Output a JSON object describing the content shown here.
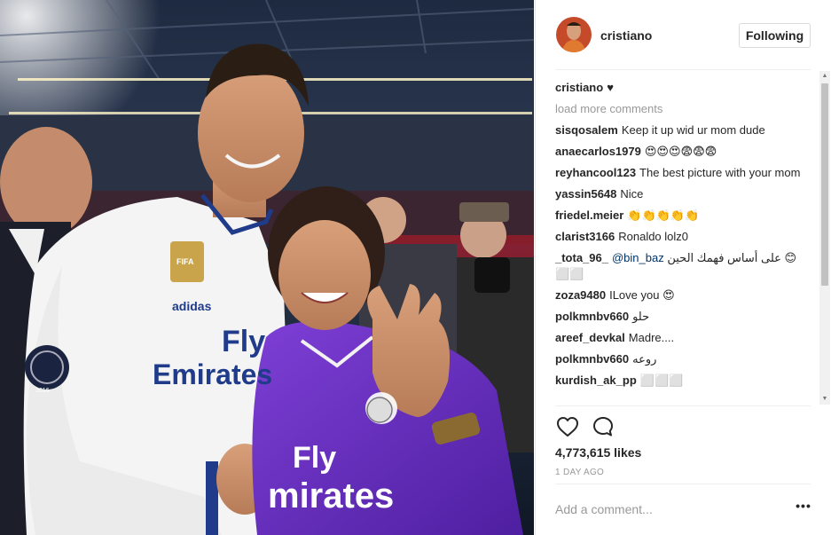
{
  "post": {
    "image_alt": "Cristiano with his mother at the stadium",
    "username": "cristiano",
    "follow_label": "Following"
  },
  "photo_text": {
    "shirt_sponsor_line1": "Fly",
    "shirt_sponsor_line2": "Emirates",
    "mom_sponsor_line1": "Fly",
    "mom_sponsor_line2": "mirates",
    "brand": "adidas",
    "badge": "FIFA",
    "patch_year": "2016"
  },
  "caption": {
    "user": "cristiano",
    "text": "♥"
  },
  "load_more_label": "load more comments",
  "comments": [
    {
      "user": "sisqosalem",
      "text": "Keep it up wid ur mom dude"
    },
    {
      "user": "anaecarlos1979",
      "text": "😍😍😍😨😨😨"
    },
    {
      "user": "reyhancool123",
      "text": "The best picture with your mom"
    },
    {
      "user": "yassin5648",
      "text": "Nice"
    },
    {
      "user": "friedel.meier",
      "text": "👏👏👏👏👏"
    },
    {
      "user": "clarist3166",
      "text": "Ronaldo lolz0"
    },
    {
      "user": "_tota_96_",
      "mention": "@bin_baz",
      "text": "على أساس فهمك الحين 😊 ⬜⬜"
    },
    {
      "user": "zoza9480",
      "text": "ILove you 😍"
    },
    {
      "user": "polkmnbv660",
      "text": "حلو"
    },
    {
      "user": "areef_devkal",
      "text": "Madre...."
    },
    {
      "user": "polkmnbv660",
      "text": "روعه"
    },
    {
      "user": "kurdish_ak_pp",
      "text": "⬜⬜⬜"
    }
  ],
  "likes_label": "4,773,615 likes",
  "timestamp": "1 DAY AGO",
  "add_comment_placeholder": "Add a comment...",
  "more_options_label": "•••",
  "icons": {
    "like": "heart-outline-icon",
    "comment": "speech-bubble-icon",
    "scroll_up": "arrow-up-icon",
    "scroll_down": "arrow-down-icon"
  },
  "colors": {
    "username": "#262626",
    "muted": "#999999",
    "mention": "#003569",
    "border": "#dbdbdb"
  }
}
